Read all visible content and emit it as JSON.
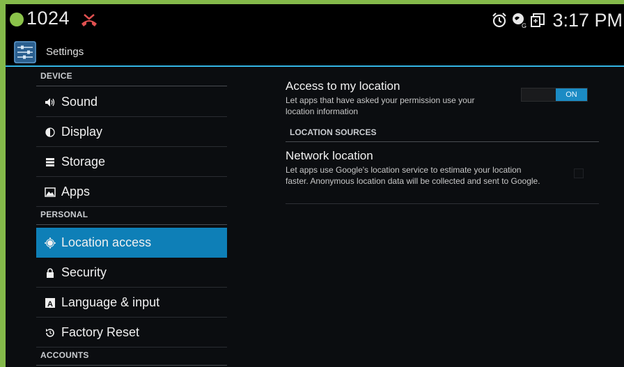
{
  "status_bar": {
    "count": "1024",
    "time": "3:17 PM",
    "icons": [
      "notification-dot-icon",
      "missed-call-icon",
      "alarm-icon",
      "location-service-icon",
      "screenshot-icon"
    ],
    "accent": "#8bc34a"
  },
  "action_bar": {
    "title": "Settings",
    "accent_line": "#33b5e5"
  },
  "sidebar": {
    "sections": {
      "device": "DEVICE",
      "personal": "PERSONAL",
      "accounts": "ACCOUNTS"
    },
    "items": [
      {
        "label": "Sound",
        "icon": "sound-icon"
      },
      {
        "label": "Display",
        "icon": "display-icon"
      },
      {
        "label": "Storage",
        "icon": "storage-icon"
      },
      {
        "label": "Apps",
        "icon": "apps-icon"
      },
      {
        "label": "Location access",
        "icon": "location-icon",
        "selected": true
      },
      {
        "label": "Security",
        "icon": "lock-icon"
      },
      {
        "label": "Language & input",
        "icon": "keyboard-icon"
      },
      {
        "label": "Factory Reset",
        "icon": "reset-icon"
      }
    ],
    "selected_color": "#0e7fb7"
  },
  "detail": {
    "access": {
      "title": "Access to my location",
      "summary": "Let apps that have asked your permission use your location information",
      "toggle_label": "ON",
      "toggle_on": true
    },
    "location_sources_header": "LOCATION SOURCES",
    "network": {
      "title": "Network location",
      "summary": "Let apps use Google's location service to estimate your location faster. Anonymous location data will be collected and sent to Google.",
      "checked": false
    }
  }
}
